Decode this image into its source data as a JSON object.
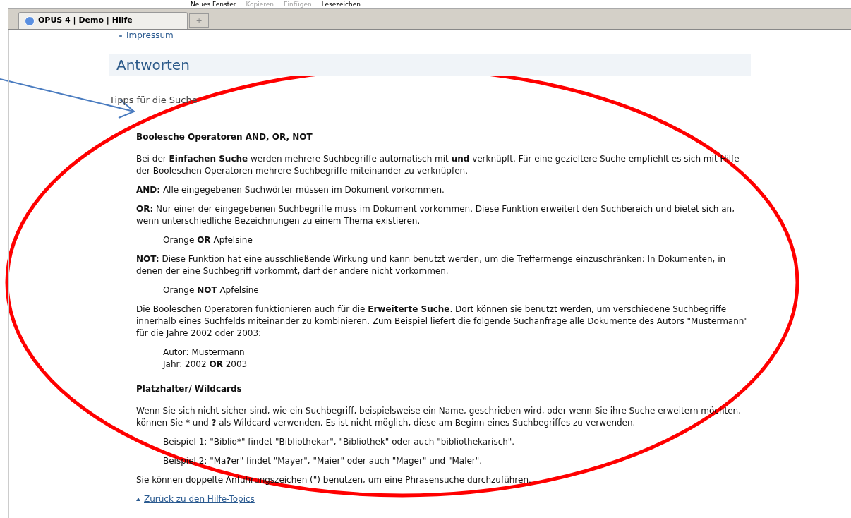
{
  "menu": [
    {
      "label": "Neues Fenster",
      "disabled": false
    },
    {
      "label": "Kopieren",
      "disabled": true
    },
    {
      "label": "Einfügen",
      "disabled": true
    },
    {
      "label": "Lesezeichen",
      "disabled": false
    }
  ],
  "tabs": [
    {
      "label": "OPUS 4 | Demo | Hilfe",
      "selected": true
    }
  ],
  "new_tab": "+",
  "nav_link": "Impressum",
  "heading": "Antworten",
  "subtitle": "Tipps für die Suche",
  "blocks": [
    {
      "kind": "heading",
      "text": "Boolesche Operatoren AND, OR, NOT"
    },
    {
      "kind": "paragraph",
      "text": "Bei der **Einfachen Suche** werden mehrere Suchbegriffe automatisch mit **und** verknüpft. Für eine gezieltere Suche empfiehlt es sich mit Hilfe der Booleschen Operatoren mehrere Suchbegriffe miteinander zu verknüpfen."
    },
    {
      "kind": "paragraph",
      "text": "**AND:** Alle eingegebenen Suchwörter müssen im Dokument vorkommen."
    },
    {
      "kind": "paragraph",
      "text": "**OR:** Nur einer der eingegebenen Suchbegriffe muss im Dokument vorkommen. Diese Funktion erweitert den Suchbereich und bietet sich an, wenn unterschiedliche Bezeichnungen zu einem Thema existieren."
    },
    {
      "kind": "example",
      "lines": [
        "Orange **OR** Apfelsine"
      ]
    },
    {
      "kind": "paragraph",
      "text": "**NOT:** Diese Funktion hat eine ausschließende Wirkung und kann benutzt werden, um die Treffermenge einzuschränken: In Dokumenten, in denen der eine Suchbegriff vorkommt, darf der andere nicht vorkommen."
    },
    {
      "kind": "example",
      "lines": [
        "Orange **NOT** Apfelsine"
      ]
    },
    {
      "kind": "paragraph",
      "text": "Die Booleschen Operatoren funktionieren auch für die **Erweiterte Suche**. Dort können sie benutzt werden, um verschiedene Suchbegriffe innerhalb eines Suchfelds miteinander zu kombinieren. Zum Beispiel liefert die folgende Suchanfrage alle Dokumente des Autors \"Mustermann\" für die Jahre 2002 oder 2003:"
    },
    {
      "kind": "example",
      "lines": [
        "Autor: Mustermann",
        "Jahr: 2002 **OR** 2003"
      ]
    },
    {
      "kind": "heading",
      "text": "Platzhalter/ Wildcards"
    },
    {
      "kind": "paragraph",
      "text": "Wenn Sie sich nicht sicher sind, wie ein Suchbegriff, beispielsweise ein Name, geschrieben wird, oder wenn Sie ihre Suche erweitern möchten, können Sie * und **?** als Wildcard verwenden. Es ist nicht möglich, diese am Beginn eines Suchbegriffes zu verwenden."
    },
    {
      "kind": "example",
      "lines": [
        "Beispiel 1: \"Biblio*\" findet \"Bibliothekar\", \"Bibliothek\" oder auch \"bibliothekarisch\"."
      ]
    },
    {
      "kind": "example",
      "lines": [
        "Beispiel 2: \"Ma**?**er\" findet \"Mayer\", \"Maier\" oder auch \"Mager\" und \"Maler\"."
      ]
    },
    {
      "kind": "paragraph",
      "text": "Sie können doppelte Anführungszeichen (\") benutzen, um eine Phrasensuche durchzuführen."
    }
  ],
  "back_link": "Zurück zu den Hilfe-Topics"
}
